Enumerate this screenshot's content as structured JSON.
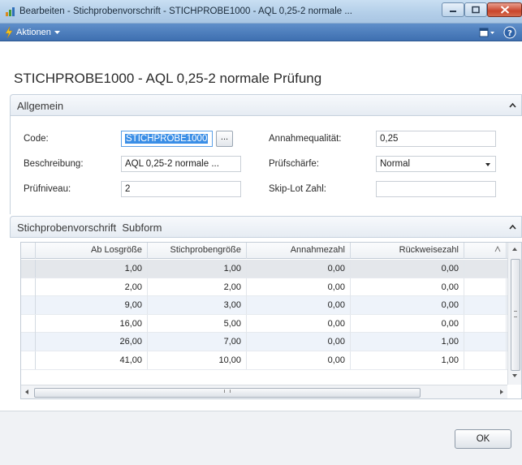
{
  "window": {
    "title": "Bearbeiten - Stichprobenvorschrift - STICHPROBE1000 - AQL 0,25-2 normale ..."
  },
  "action_bar": {
    "actions_label": "Aktionen",
    "actions_icon": "lightning-icon",
    "view_icon": "view-options-icon",
    "help_icon": "help-icon"
  },
  "page": {
    "title": "STICHPROBE1000 - AQL 0,25-2 normale Prüfung"
  },
  "general": {
    "header": "Allgemein",
    "fields": {
      "code_label": "Code:",
      "code_value": "STICHPROBE1000",
      "assist_label": "...",
      "description_label": "Beschreibung:",
      "description_value": "AQL 0,25-2 normale ...",
      "level_label": "Prüfniveau:",
      "level_value": "2",
      "aql_label": "Annahmequalität:",
      "aql_value": "0,25",
      "severity_label": "Prüfschärfe:",
      "severity_value": "Normal",
      "skiplot_label": "Skip-Lot Zahl:",
      "skiplot_value": ""
    }
  },
  "subform": {
    "header": "Stichprobenvorschrift  Subform",
    "columns": [
      "Ab Losgröße",
      "Stichprobengröße",
      "Annahmezahl",
      "Rückweisezahl"
    ],
    "rows": [
      [
        "1,00",
        "1,00",
        "0,00",
        "0,00"
      ],
      [
        "2,00",
        "2,00",
        "0,00",
        "0,00"
      ],
      [
        "9,00",
        "3,00",
        "0,00",
        "0,00"
      ],
      [
        "16,00",
        "5,00",
        "0,00",
        "0,00"
      ],
      [
        "26,00",
        "7,00",
        "0,00",
        "1,00"
      ],
      [
        "41,00",
        "10,00",
        "0,00",
        "1,00"
      ]
    ]
  },
  "footer": {
    "ok_label": "OK"
  },
  "colors": {
    "titlebar": "#b4cfe9",
    "actionbar": "#4a7cbd",
    "selection": "#3a8ee6",
    "close_button": "#c8452c"
  }
}
